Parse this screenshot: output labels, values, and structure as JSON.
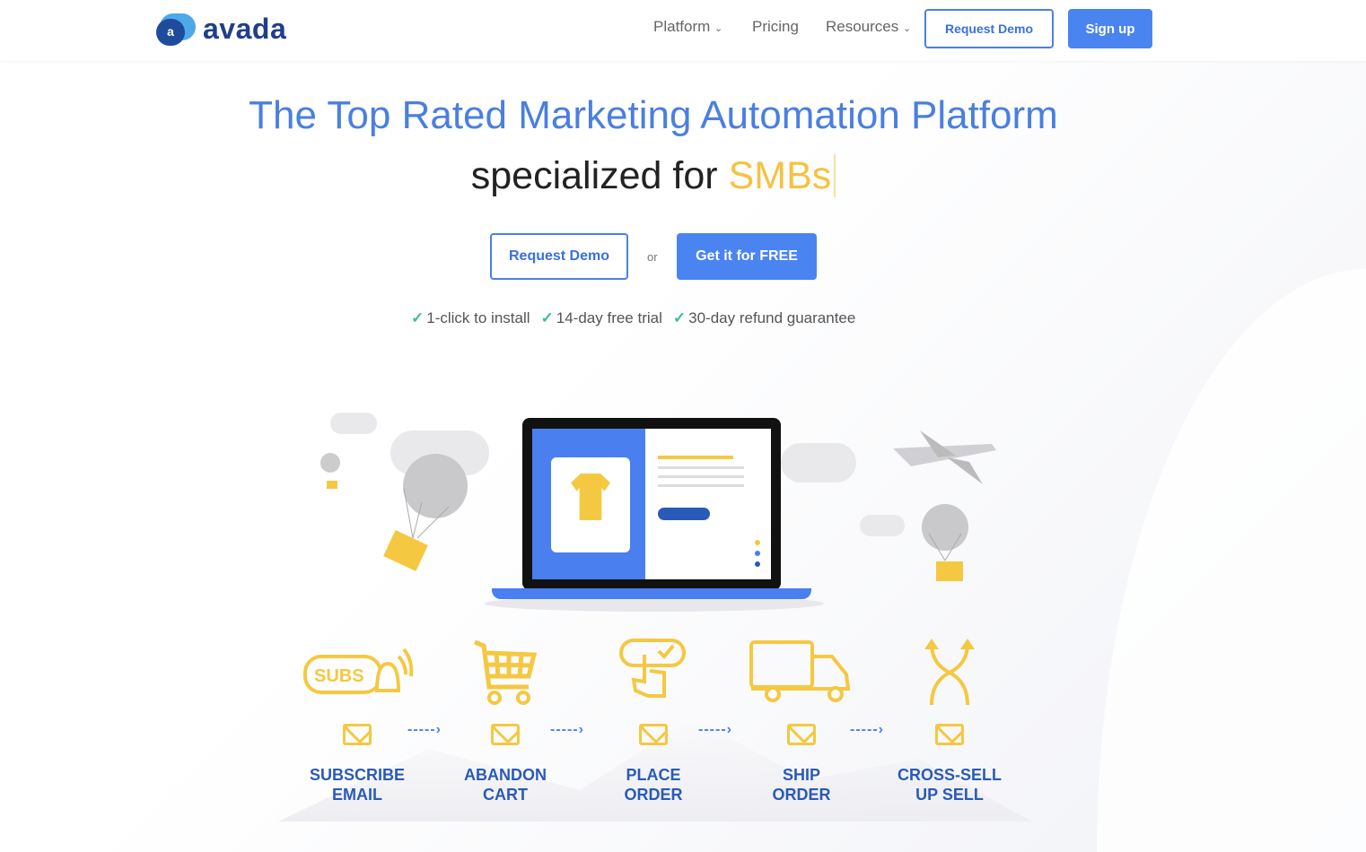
{
  "nav": {
    "logo": "avada",
    "logo_letter": "a",
    "items": [
      {
        "label": "Platform",
        "dropdown": true
      },
      {
        "label": "Pricing",
        "dropdown": false
      },
      {
        "label": "Resources",
        "dropdown": true
      }
    ],
    "request_demo": "Request Demo",
    "signup": "Sign up"
  },
  "hero": {
    "title": "The Top Rated Marketing Automation Platform",
    "subtitle_prefix": "specialized for",
    "subtitle_highlight": "SMBs",
    "request_demo": "Request Demo",
    "or": "or",
    "cta": "Get it for FREE",
    "checks": [
      "1-click to install",
      "14-day free trial",
      "30-day refund guarantee"
    ]
  },
  "illustration": {
    "subs_text": "SUBS",
    "stages": [
      {
        "line1": "SUBSCRIBE",
        "line2": "EMAIL",
        "icon": "subscribe-bell-icon"
      },
      {
        "line1": "ABANDON",
        "line2": "CART",
        "icon": "cart-icon"
      },
      {
        "line1": "PLACE",
        "line2": "ORDER",
        "icon": "tap-order-icon"
      },
      {
        "line1": "SHIP",
        "line2": "ORDER",
        "icon": "truck-icon"
      },
      {
        "line1": "CROSS-SELL",
        "line2": "UP SELL",
        "icon": "cross-arrows-icon"
      }
    ]
  },
  "colors": {
    "primary": "#4a84f0",
    "accent": "#f5c242",
    "label": "#2a5ab8",
    "check": "#3cbf8f"
  }
}
